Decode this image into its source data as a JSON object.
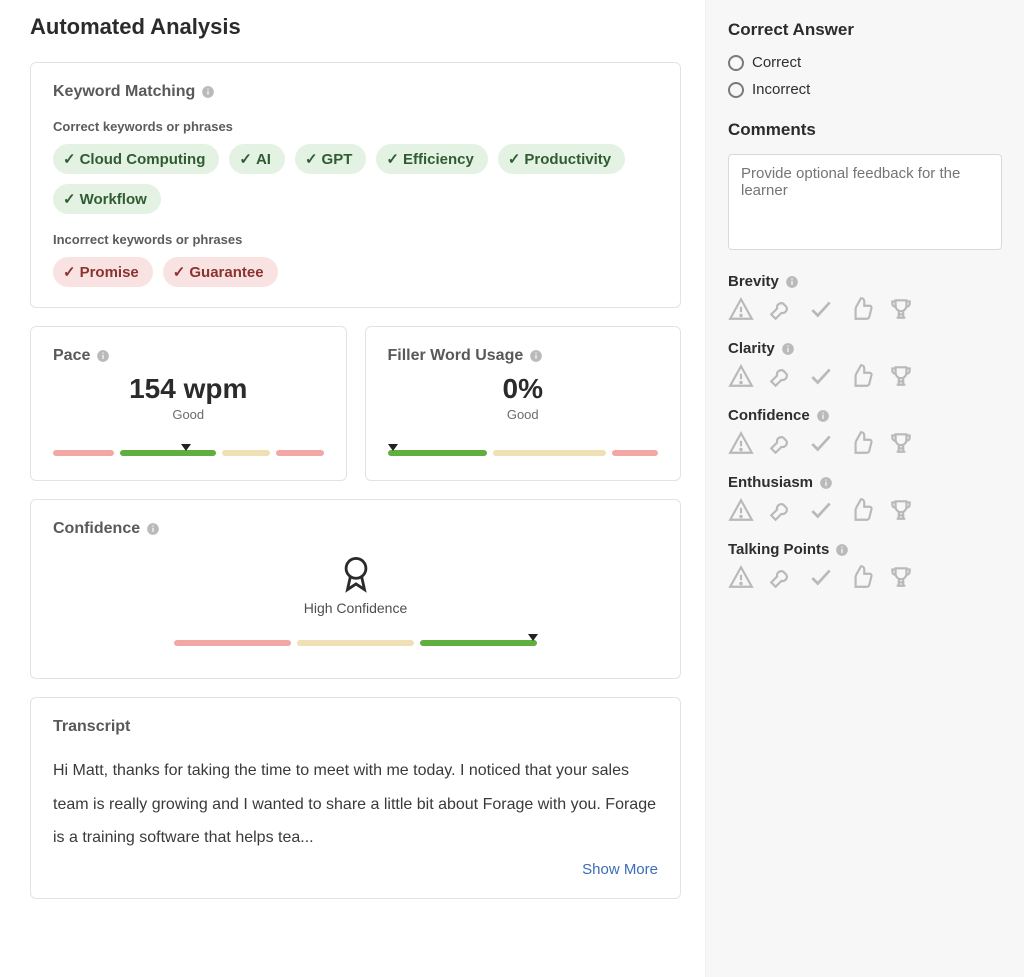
{
  "page": {
    "title": "Automated Analysis"
  },
  "keywords": {
    "section_title": "Keyword Matching",
    "correct_label": "Correct keywords or phrases",
    "incorrect_label": "Incorrect keywords or phrases",
    "correct": [
      "Cloud Computing",
      "AI",
      "GPT",
      "Efficiency",
      "Productivity",
      "Workflow"
    ],
    "incorrect": [
      "Promise",
      "Guarantee"
    ]
  },
  "pace": {
    "title": "Pace",
    "value": "154 wpm",
    "rating": "Good",
    "segments": [
      {
        "color": "pink",
        "flex": 18
      },
      {
        "color": "green",
        "flex": 28
      },
      {
        "color": "tan",
        "flex": 14
      },
      {
        "color": "pink",
        "flex": 14
      }
    ],
    "pointer_percent": 49
  },
  "filler": {
    "title": "Filler Word Usage",
    "value": "0%",
    "rating": "Good",
    "segments": [
      {
        "color": "green",
        "flex": 30
      },
      {
        "color": "tan",
        "flex": 34
      },
      {
        "color": "pink",
        "flex": 14
      }
    ],
    "pointer_percent": 2
  },
  "confidence": {
    "title": "Confidence",
    "label": "High Confidence",
    "segments": [
      {
        "color": "pink",
        "flex": 33
      },
      {
        "color": "tan",
        "flex": 33
      },
      {
        "color": "green",
        "flex": 33
      }
    ],
    "pointer_percent": 99
  },
  "transcript": {
    "title": "Transcript",
    "body": "Hi Matt, thanks for taking the time to meet with me today. I noticed that your sales team is really growing and I wanted to share a little bit about Forage with you. Forage is a training software that helps tea...",
    "show_more": "Show More"
  },
  "side": {
    "correct_answer_title": "Correct Answer",
    "options": [
      "Correct",
      "Incorrect"
    ],
    "comments_title": "Comments",
    "comments_placeholder": "Provide optional feedback for the learner",
    "criteria": [
      "Brevity",
      "Clarity",
      "Confidence",
      "Enthusiasm",
      "Talking Points"
    ],
    "rating_icons": [
      "warning",
      "wrench",
      "check",
      "thumbs-up",
      "trophy"
    ]
  }
}
